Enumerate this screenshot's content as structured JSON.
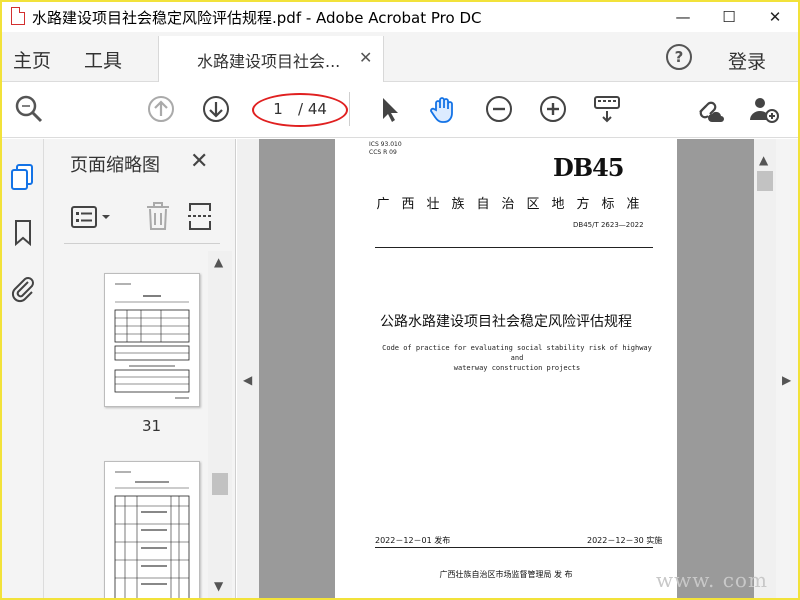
{
  "window": {
    "title": "水路建设项目社会稳定风险评估规程.pdf - Adobe Acrobat Pro DC",
    "minimize": "—",
    "maximize": "☐",
    "close": "✕"
  },
  "tabs": {
    "home": "主页",
    "tools": "工具",
    "document": "水路建设项目社会...",
    "document_close": "✕",
    "help": "?",
    "login": "登录"
  },
  "toolbar": {
    "current_page": "1",
    "total_pages": "/ 44"
  },
  "panel": {
    "title": "页面缩略图",
    "close": "✕",
    "thumbnails": [
      {
        "label": "31"
      }
    ]
  },
  "page": {
    "ics": "ICS  93.010",
    "ccs": "CCS  R 09",
    "logo": "DB45",
    "standard_type": "广西壮族自治区地方标准",
    "standard_no": "DB45/T 2623—2022",
    "title": "公路水路建设项目社会稳定风险评估规程",
    "subtitle_en_line1": "Code of practice for evaluating social stability risk of highway and",
    "subtitle_en_line2": "waterway construction projects",
    "publish_date": "2022－12－01 发布",
    "implement_date": "2022－12－30 实施",
    "issuer": "广西壮族自治区市场监督管理局      发 布"
  },
  "watermark": "www.      com",
  "icons": [
    "search-icon",
    "up-arrow-icon",
    "down-arrow-icon",
    "select-cursor-icon",
    "hand-icon",
    "zoom-out-icon",
    "zoom-in-icon",
    "keyboard-icon",
    "link-cloud-icon",
    "add-user-icon",
    "pages-icon",
    "bookmark-icon",
    "attachment-icon",
    "options-icon",
    "trash-icon",
    "page-extract-icon"
  ],
  "colors": {
    "accent": "#1473e6",
    "annotation": "#e02020"
  }
}
